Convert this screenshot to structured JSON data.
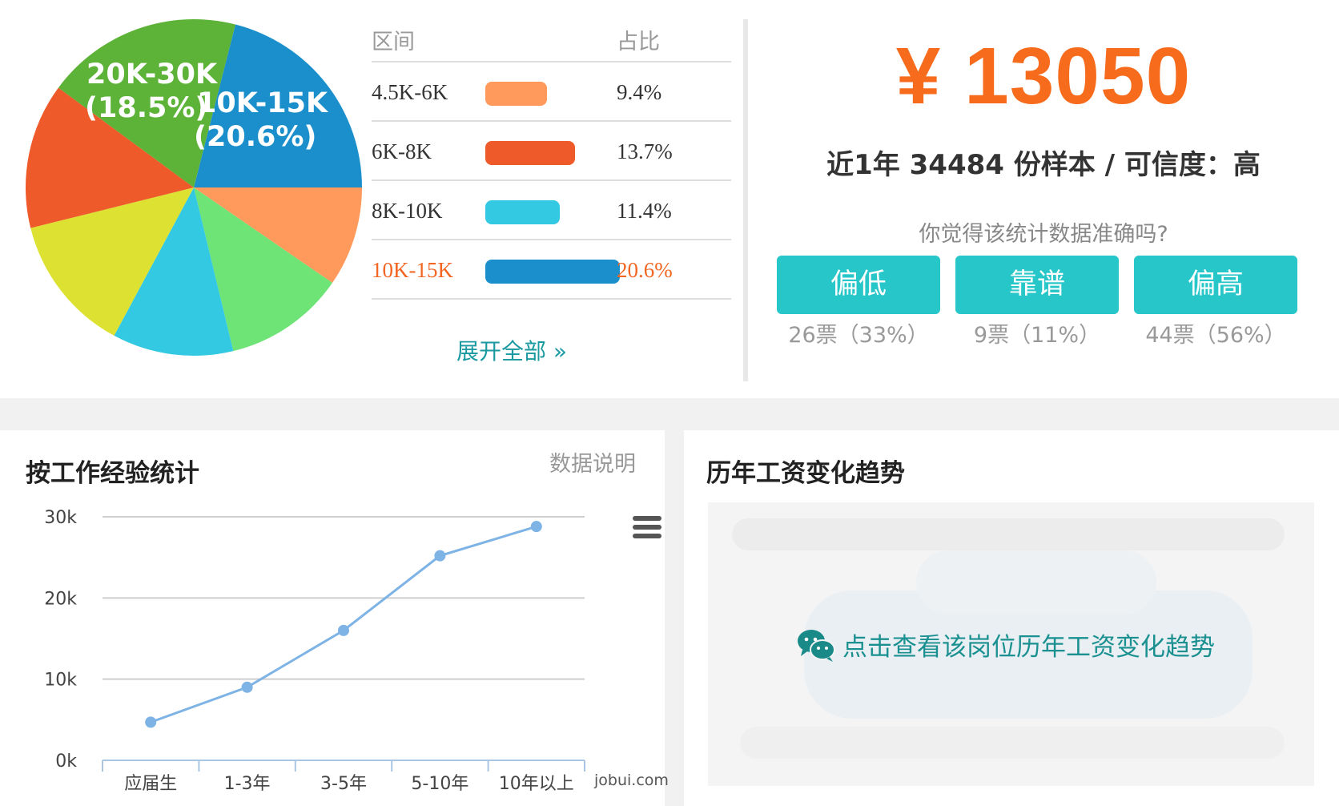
{
  "distribution": {
    "header_range": "区间",
    "header_ratio": "占比",
    "rows": [
      {
        "range": "4.5K-6K",
        "pct": "9.4%",
        "value": 9.4,
        "color": "#ff9a5c",
        "highlight": false
      },
      {
        "range": "6K-8K",
        "pct": "13.7%",
        "value": 13.7,
        "color": "#ee5a2a",
        "highlight": false
      },
      {
        "range": "8K-10K",
        "pct": "11.4%",
        "value": 11.4,
        "color": "#33c9e2",
        "highlight": false
      },
      {
        "range": "10K-15K",
        "pct": "20.6%",
        "value": 20.6,
        "color": "#1b8fcb",
        "highlight": true
      }
    ],
    "expand_label": "展开全部 »"
  },
  "pie": {
    "slices": [
      {
        "label": "10K-15K",
        "value": 20.6,
        "color": "#1b8fcb"
      },
      {
        "label": "",
        "value": 9.4,
        "color": "#ff9a5c"
      },
      {
        "label": "",
        "value": 11.4,
        "color": "#6ee476"
      },
      {
        "label": "",
        "value": 11.4,
        "color": "#33c9e2"
      },
      {
        "label": "",
        "value": 13.0,
        "color": "#dde132"
      },
      {
        "label": "",
        "value": 13.7,
        "color": "#ee5a2a"
      },
      {
        "label": "20K-30K",
        "value": 18.5,
        "color": "#5cb338"
      }
    ],
    "labels": {
      "a1": "20K-30K",
      "a2": "(18.5%)",
      "b1": "10K-15K",
      "b2": "(20.6%)"
    }
  },
  "summary": {
    "salary": "¥ 13050",
    "sample_line": "近1年 34484 份样本 / 可信度：高",
    "question": "你觉得该统计数据准确吗?",
    "votes": [
      {
        "label": "偏低",
        "count": "26票（33%）"
      },
      {
        "label": "靠谱",
        "count": "9票（11%）"
      },
      {
        "label": "偏高",
        "count": "44票（56%）"
      }
    ]
  },
  "experience": {
    "title": "按工作经验统计",
    "note": "数据说明",
    "watermark": "jobui.com",
    "chart_data": {
      "type": "line",
      "categories": [
        "应届生",
        "1-3年",
        "3-5年",
        "5-10年",
        "10年以上"
      ],
      "values": [
        4700,
        9000,
        16000,
        25200,
        28800
      ],
      "y_ticks": [
        "0k",
        "10k",
        "20k",
        "30k"
      ],
      "ylim": [
        0,
        30000
      ],
      "color": "#7eb3e6",
      "grid": true
    }
  },
  "trend": {
    "title": "历年工资变化趋势",
    "cta": "点击查看该岗位历年工资变化趋势"
  },
  "colors": {
    "accent": "#f76b1c",
    "teal": "#26c6c9",
    "link": "#1a9aa0"
  }
}
